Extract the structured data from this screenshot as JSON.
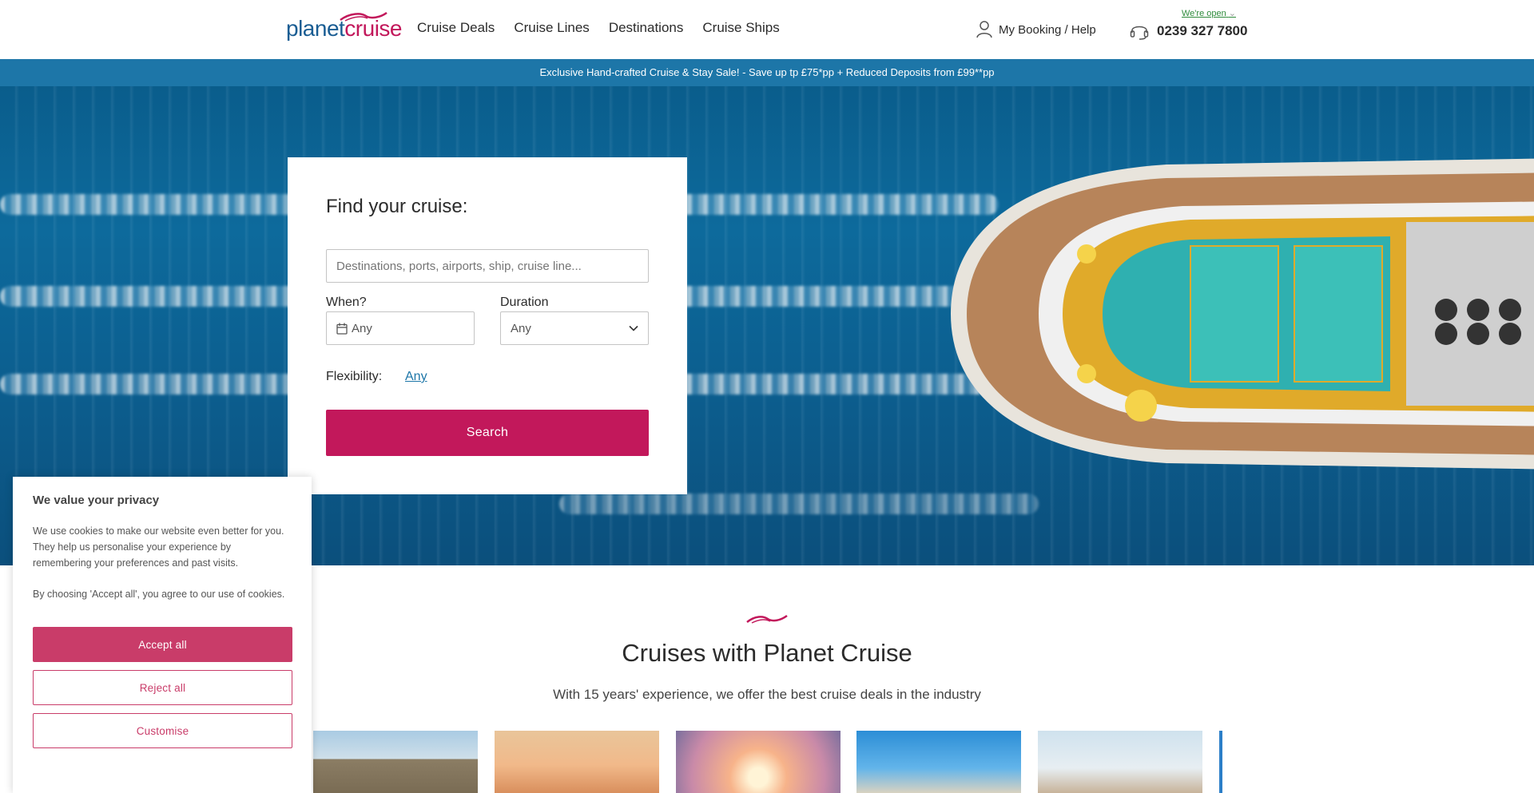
{
  "header": {
    "logo_part1": "planet",
    "logo_part2": "cruise",
    "nav": [
      "Cruise Deals",
      "Cruise Lines",
      "Destinations",
      "Cruise Ships"
    ],
    "booking_label": "My Booking / Help",
    "open_status": "We're open",
    "phone_number": "0239 327 7800"
  },
  "banner": {
    "text": "Exclusive Hand-crafted Cruise & Stay Sale! - Save up tp £75*pp + Reduced Deposits from £99**pp"
  },
  "search": {
    "title": "Find your cruise:",
    "destination_placeholder": "Destinations, ports, airports, ship, cruise line...",
    "when_label": "When?",
    "when_value": "Any",
    "duration_label": "Duration",
    "duration_value": "Any",
    "flexibility_label": "Flexibility:",
    "flexibility_value": "Any",
    "search_button": "Search"
  },
  "section": {
    "title": "Cruises with Planet Cruise",
    "subtitle": "With 15 years' experience, we offer the best cruise deals in the industry"
  },
  "cookie": {
    "title": "We value your privacy",
    "text1": "We use cookies to make our website even better for you. They help us personalise your experience by remembering your preferences and past visits.",
    "text2": "By choosing 'Accept all', you agree to our use of cookies.",
    "accept": "Accept all",
    "reject": "Reject all",
    "customise": "Customise"
  },
  "colors": {
    "brand_blue": "#1a5d93",
    "brand_pink": "#c2185b",
    "banner_blue": "#1d76a8",
    "open_green": "#2e8b3b"
  }
}
